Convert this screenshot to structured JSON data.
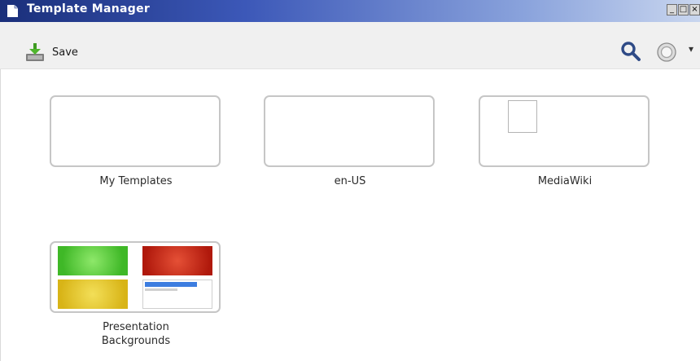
{
  "window": {
    "title": "Template Manager",
    "controls": [
      "_",
      "□",
      "×"
    ]
  },
  "toolbar": {
    "save_label": "Save",
    "icons": [
      "save-icon",
      "search-icon",
      "settings-icon",
      "dropdown-arrow-icon"
    ],
    "dropdown_arrow": "▾"
  },
  "folders": [
    {
      "label": "My Templates",
      "thumbnail": "empty"
    },
    {
      "label": "en-US",
      "thumbnail": "empty"
    },
    {
      "label": "MediaWiki",
      "thumbnail": "single-document"
    },
    {
      "label_line1": "Presentation",
      "label_line2": "Backgrounds",
      "thumbnail": "four-backgrounds"
    }
  ],
  "colors": {
    "titlebar_start": "#1a2f7a",
    "titlebar_end": "#c9d6ef",
    "background_green": "#3fb827",
    "background_red": "#b0190c",
    "background_yellow": "#d8b417",
    "accent_blue": "#3d7de0",
    "search_icon": "#2e4a86"
  }
}
